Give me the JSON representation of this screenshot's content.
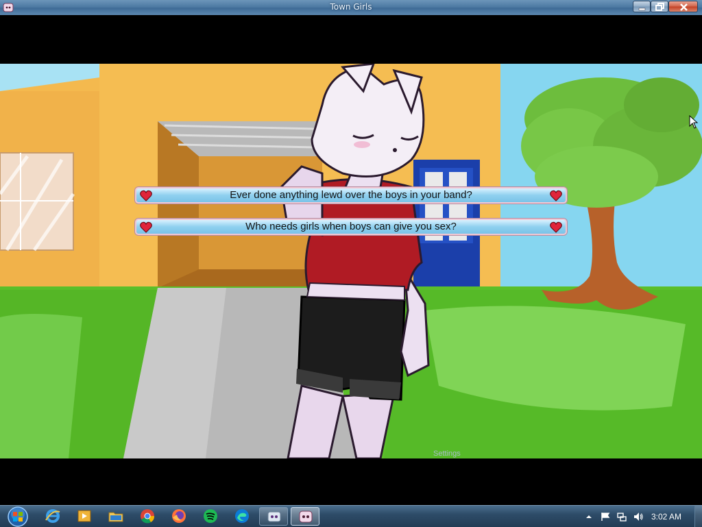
{
  "window": {
    "title": "Town Girls"
  },
  "dialogue": {
    "choices": [
      {
        "label": "Ever done anything lewd over the boys in your band?"
      },
      {
        "label": "Who needs girls when boys can give you sex?"
      }
    ],
    "menu": {
      "settings_label": "Settings"
    }
  },
  "taskbar": {
    "clock": "3:02 AM",
    "pinned": [
      "internet-explorer-icon",
      "media-player-icon",
      "file-explorer-icon",
      "chrome-icon",
      "firefox-icon",
      "spotify-icon",
      "edge-icon"
    ],
    "running": [
      "game-launcher-icon",
      "town-girls-icon"
    ],
    "tray": [
      "tray-up-arrow-icon",
      "flag-icon",
      "network-icon",
      "volume-icon"
    ]
  },
  "colors": {
    "choice_fill": "#8fd0ef",
    "heart": "#e0243a",
    "wall": "#f4b94e",
    "grass": "#5bbf2a",
    "sky": "#7fd3ef",
    "titlebar": "#4e7aa3"
  }
}
